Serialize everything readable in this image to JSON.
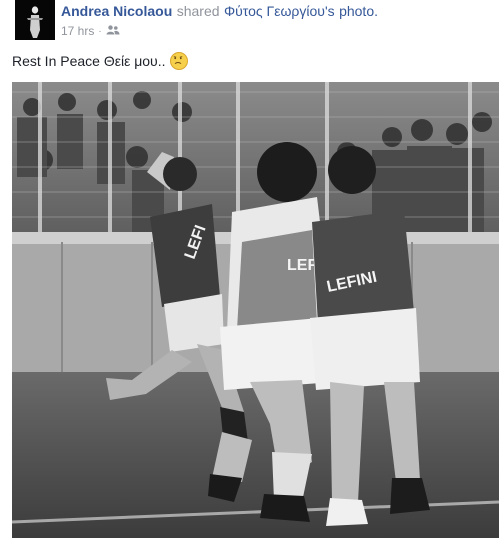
{
  "post": {
    "author": "Andrea Nicolaou",
    "action": "shared",
    "shared_from": "Φύτος Γεωργίου's",
    "shared_object": "photo.",
    "timestamp": "17 hrs",
    "separator": "·",
    "caption": "Rest In Peace Θείε μου..",
    "caption_emoji": "sad-face-icon",
    "privacy_icon": "friends-icon"
  },
  "photo": {
    "kind": "black-and-white football photo",
    "jersey_text_left": "LEFI",
    "jersey_text_center": "LEF",
    "jersey_text_right": "LEFINI"
  }
}
